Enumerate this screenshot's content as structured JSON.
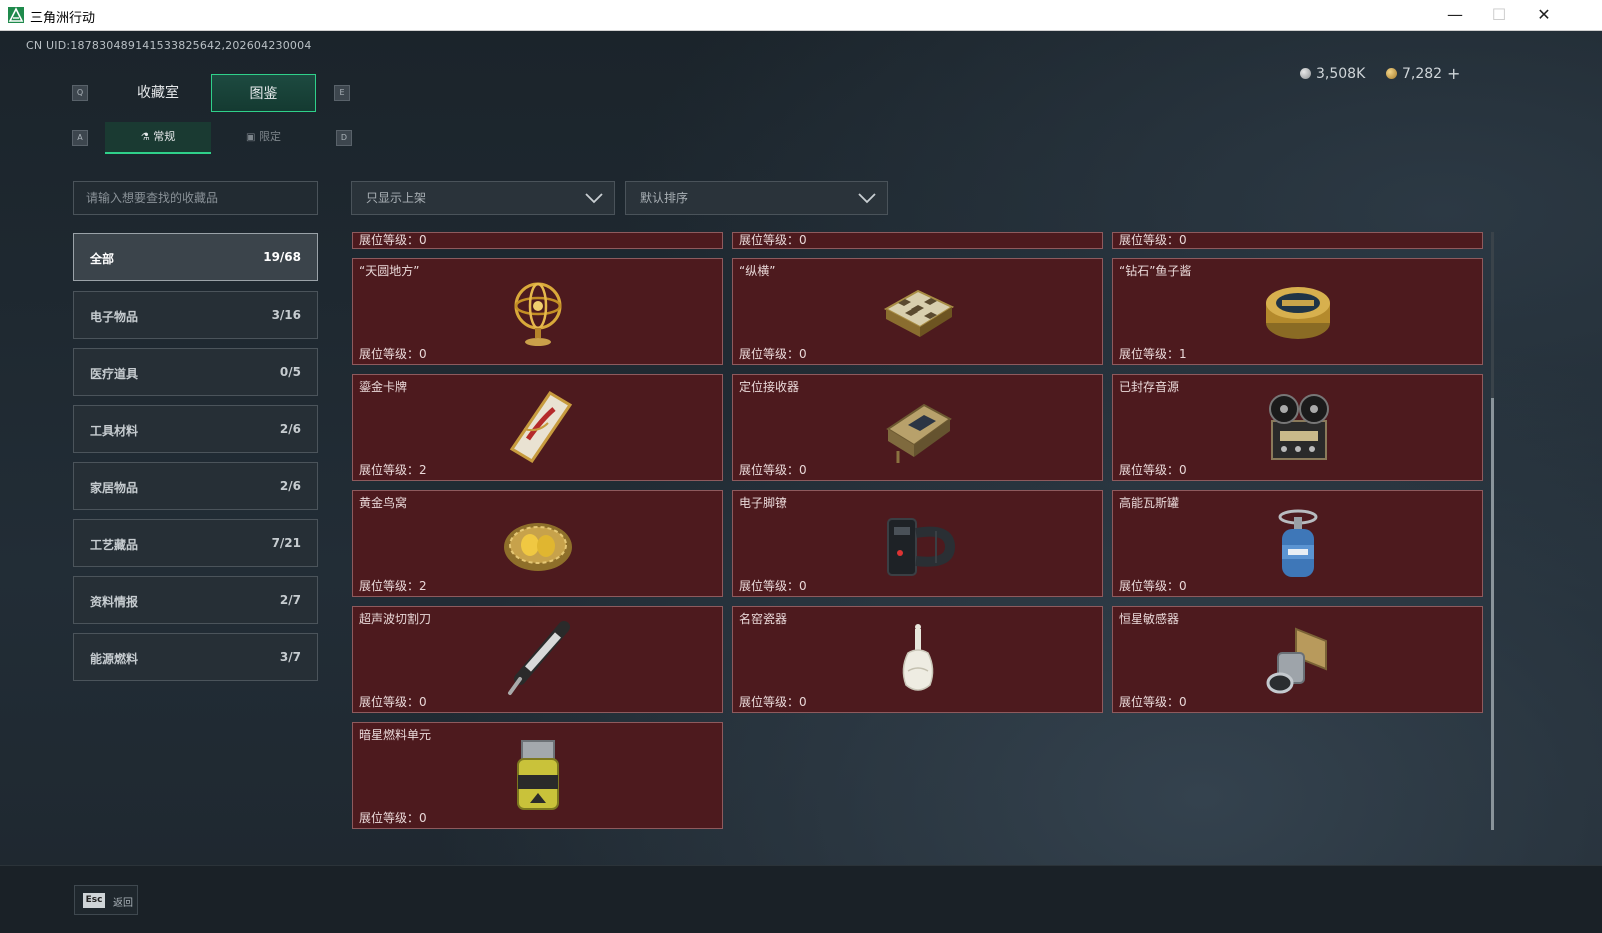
{
  "window": {
    "title": "三角洲行动",
    "minimize": "—",
    "maximize": "☐",
    "close": "✕"
  },
  "uid": "CN UID:187830489141533825642,202604230004",
  "currency": {
    "silver": "3,508K",
    "gold": "7,282",
    "add": "+"
  },
  "tabs": [
    {
      "label": "收藏室",
      "key": "Q"
    },
    {
      "label": "图鉴",
      "key": "E"
    }
  ],
  "subtabs": [
    {
      "label": "常规",
      "key": "A"
    },
    {
      "label": "限定",
      "key": "D"
    }
  ],
  "search": {
    "placeholder": "请输入想要查找的收藏品"
  },
  "filters": {
    "shelf": "只显示上架",
    "sort": "默认排序"
  },
  "categories": [
    {
      "label": "全部",
      "count": "19/68"
    },
    {
      "label": "电子物品",
      "count": "3/16"
    },
    {
      "label": "医疗道具",
      "count": "0/5"
    },
    {
      "label": "工具材料",
      "count": "2/6"
    },
    {
      "label": "家居物品",
      "count": "2/6"
    },
    {
      "label": "工艺藏品",
      "count": "7/21"
    },
    {
      "label": "资料情报",
      "count": "2/7"
    },
    {
      "label": "能源燃料",
      "count": "3/7"
    }
  ],
  "partial_row": [
    {
      "level": "展位等级：0"
    },
    {
      "level": "展位等级：0"
    },
    {
      "level": "展位等级：0"
    }
  ],
  "items": [
    {
      "name": "“天圆地方”",
      "level": "展位等级：0",
      "icon": "armillary-sphere-icon"
    },
    {
      "name": "“纵横”",
      "level": "展位等级：0",
      "icon": "chessboard-icon"
    },
    {
      "name": "“钻石”鱼子酱",
      "level": "展位等级：1",
      "icon": "caviar-tin-icon"
    },
    {
      "name": "鎏金卡牌",
      "level": "展位等级：2",
      "icon": "gilded-card-icon"
    },
    {
      "name": "定位接收器",
      "level": "展位等级：0",
      "icon": "receiver-icon"
    },
    {
      "name": "已封存音源",
      "level": "展位等级：0",
      "icon": "reel-recorder-icon"
    },
    {
      "name": "黄金鸟窝",
      "level": "展位等级：2",
      "icon": "golden-nest-icon"
    },
    {
      "name": "电子脚镣",
      "level": "展位等级：0",
      "icon": "ankle-monitor-icon"
    },
    {
      "name": "高能瓦斯罐",
      "level": "展位等级：0",
      "icon": "gas-canister-icon"
    },
    {
      "name": "超声波切割刀",
      "level": "展位等级：0",
      "icon": "ultrasonic-cutter-icon"
    },
    {
      "name": "名窑瓷器",
      "level": "展位等级：0",
      "icon": "porcelain-vase-icon"
    },
    {
      "name": "恒星敏感器",
      "level": "展位等级：0",
      "icon": "star-sensor-icon"
    },
    {
      "name": "暗星燃料单元",
      "level": "展位等级：0",
      "icon": "fuel-cell-icon"
    }
  ],
  "footer": {
    "esc_key": "Esc",
    "back_label": "返回"
  },
  "colors": {
    "accent": "#2fd08a",
    "card_bg": "#4d1a1e",
    "card_border": "#8e5a5d",
    "page_bg": "#1d252c"
  }
}
